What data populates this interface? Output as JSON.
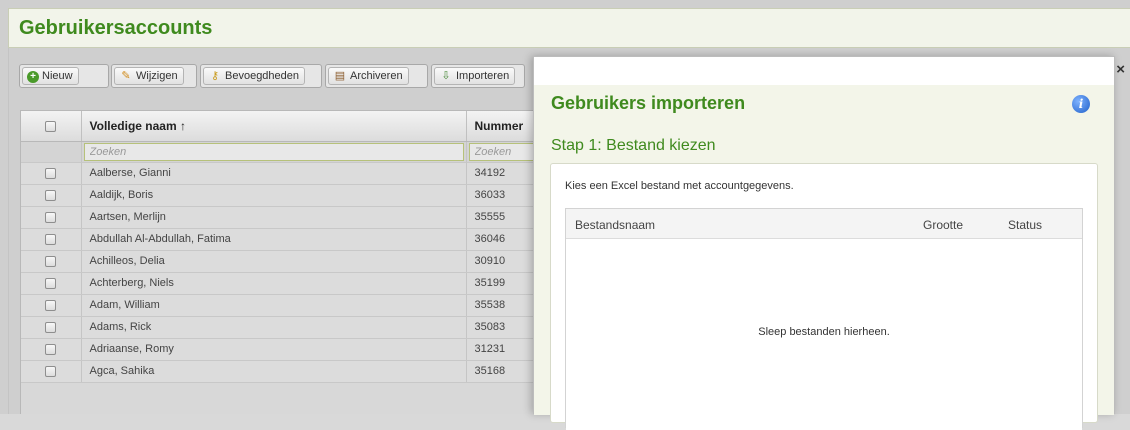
{
  "page": {
    "title": "Gebruikersaccounts"
  },
  "toolbar": {
    "new_label": "Nieuw",
    "edit_label": "Wijzigen",
    "permissions_label": "Bevoegdheden",
    "archive_label": "Archiveren",
    "import_label": "Importeren"
  },
  "table": {
    "columns": {
      "name": "Volledige naam ↑",
      "number": "Nummer"
    },
    "search_placeholder": "Zoeken",
    "rows": [
      {
        "name": "Aalberse, Gianni",
        "number": "34192"
      },
      {
        "name": "Aaldijk, Boris",
        "number": "36033"
      },
      {
        "name": "Aartsen, Merlijn",
        "number": "35555"
      },
      {
        "name": "Abdullah Al-Abdullah, Fatima",
        "number": "36046"
      },
      {
        "name": "Achilleos, Delia",
        "number": "30910"
      },
      {
        "name": "Achterberg, Niels",
        "number": "35199"
      },
      {
        "name": "Adam, William",
        "number": "35538"
      },
      {
        "name": "Adams, Rick",
        "number": "35083"
      },
      {
        "name": "Adriaanse, Romy",
        "number": "31231"
      },
      {
        "name": "Agca, Sahika",
        "number": "35168"
      }
    ]
  },
  "modal": {
    "close": "×",
    "title": "Gebruikers importeren",
    "step_title": "Stap 1: Bestand kiezen",
    "description": "Kies een Excel bestand met accountgegevens.",
    "file_columns": {
      "filename": "Bestandsnaam",
      "size": "Grootte",
      "status": "Status"
    },
    "drop_text": "Sleep bestanden hierheen."
  },
  "icons": {
    "new": "plus-circle-icon",
    "edit": "pencil-icon",
    "permissions": "key-icon",
    "archive": "archive-box-icon",
    "import": "import-icon",
    "info": "info-icon"
  },
  "colors": {
    "accent_green": "#3f8a1e",
    "info_blue": "#1f5fc9"
  }
}
